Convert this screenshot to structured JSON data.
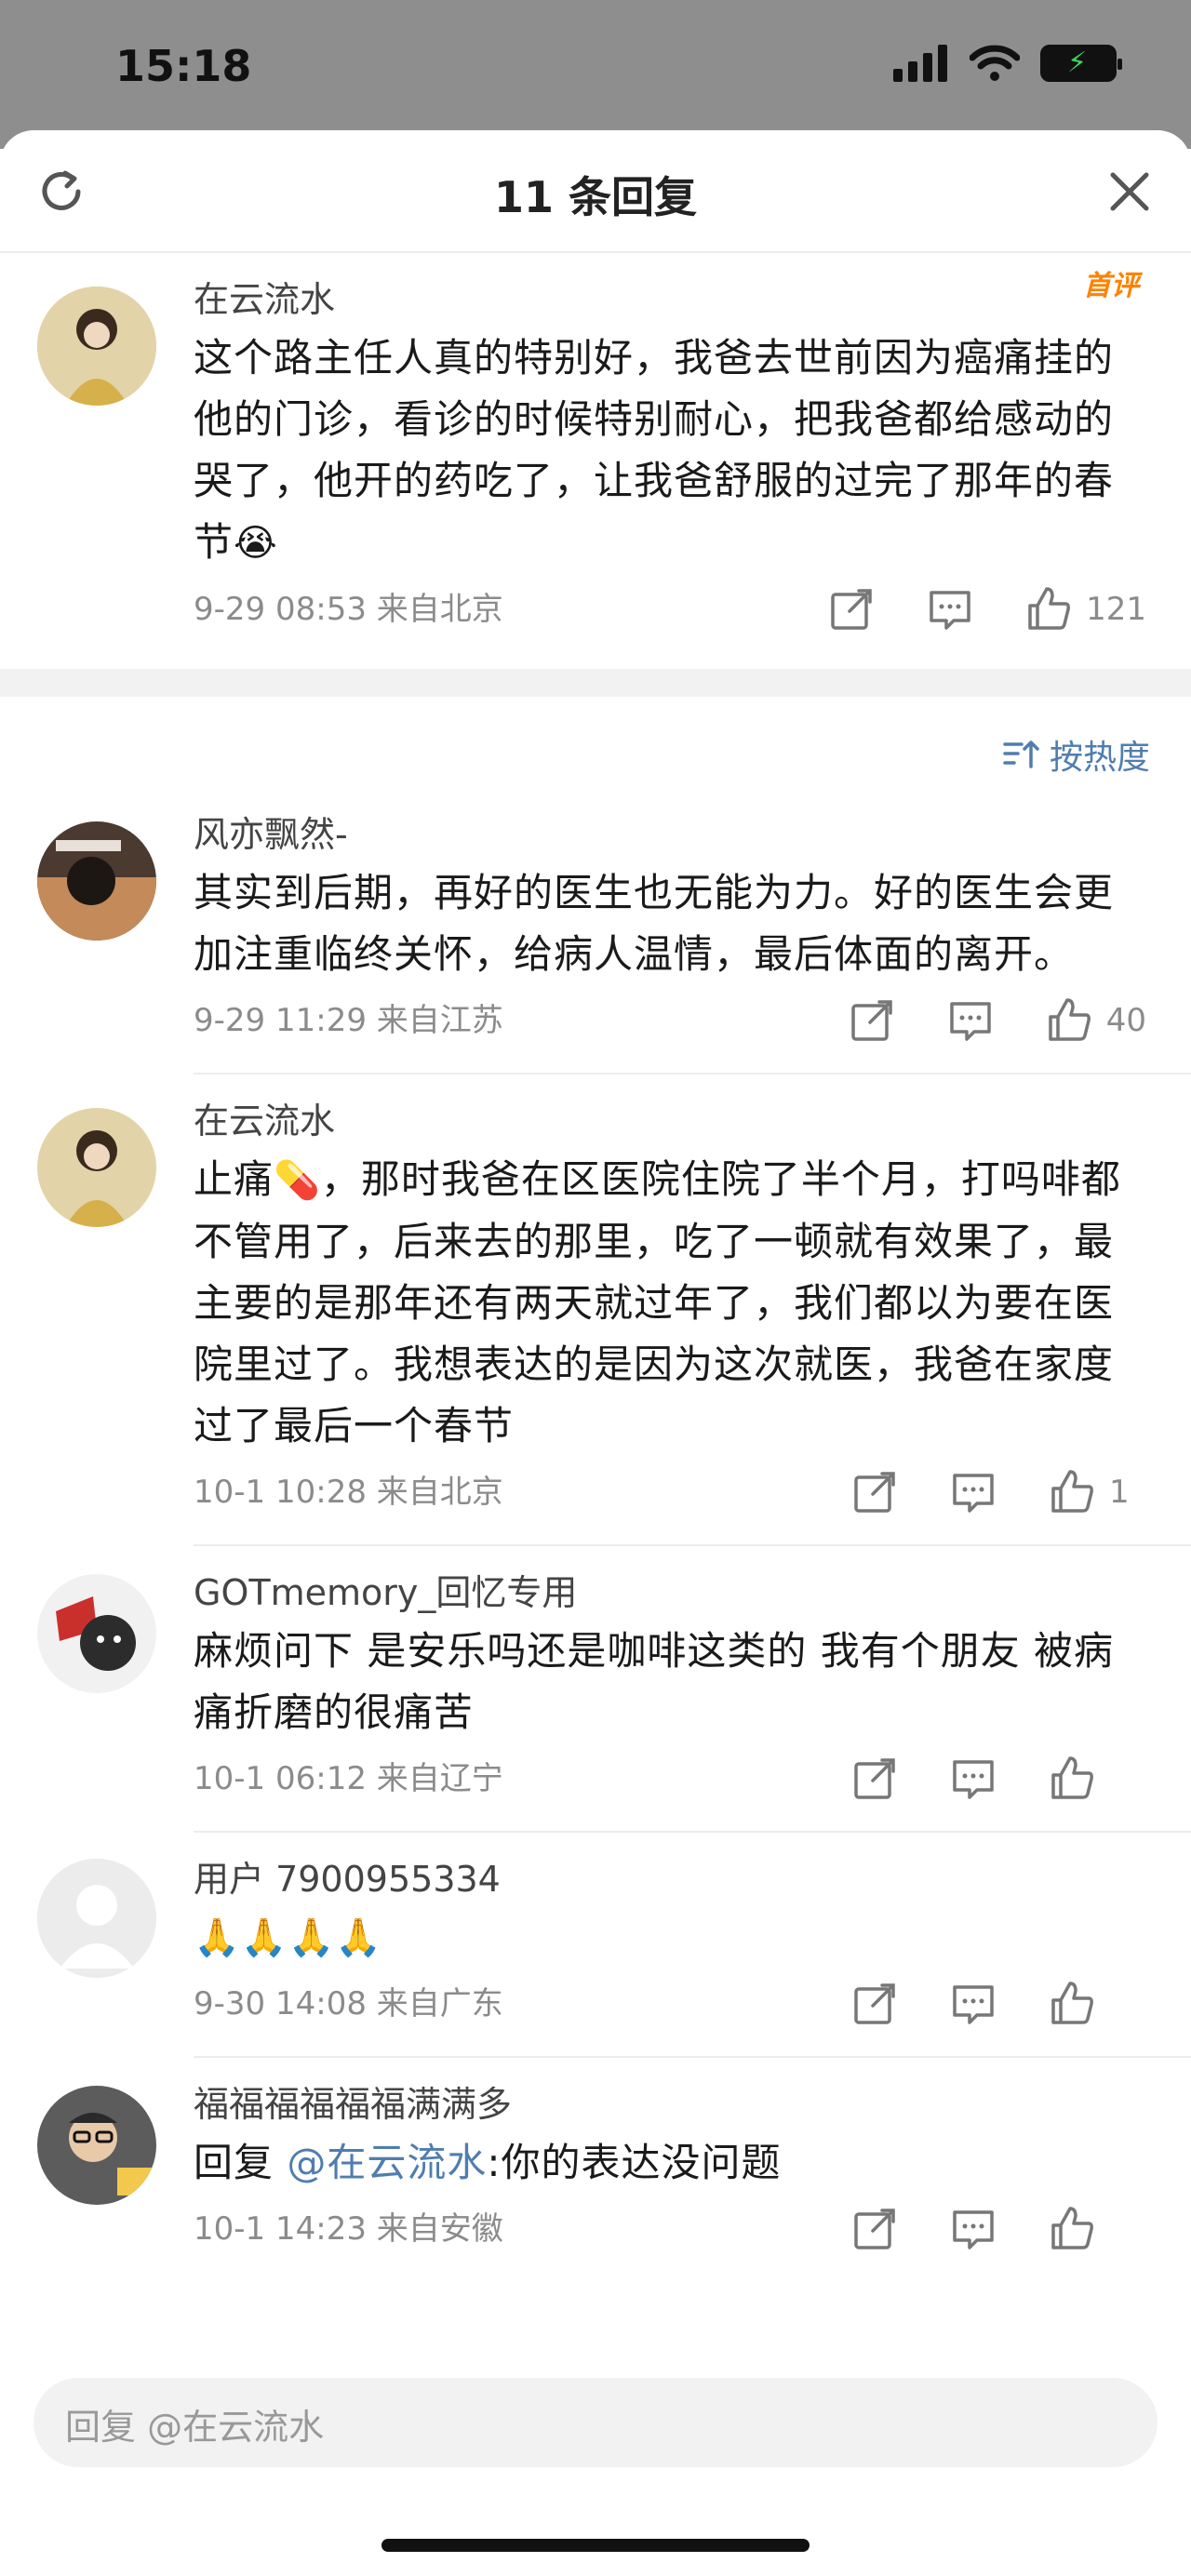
{
  "status": {
    "time": "15:18"
  },
  "sheet": {
    "title": "11 条回复"
  },
  "top_comment": {
    "name": "在云流水",
    "badge": "首评",
    "text": "这个路主任人真的特别好，我爸去世前因为癌痛挂的他的门诊，看诊的时候特别耐心，把我爸都给感动的哭了，他开的药吃了，让我爸舒服的过完了那年的春节",
    "emoji": "😭",
    "meta": "9-29 08:53  来自北京",
    "likes": "121"
  },
  "sort": {
    "label": "按热度"
  },
  "replies": [
    {
      "name": "风亦飘然-",
      "text": "其实到后期，再好的医生也无能为力。好的医生会更加注重临终关怀，给病人温情，最后体面的离开。",
      "meta": "9-29 11:29  来自江苏",
      "likes": "40"
    },
    {
      "name": "在云流水",
      "text_pre": "止痛",
      "emoji": "💊",
      "text": "，那时我爸在区医院住院了半个月，打吗啡都不管用了，后来去的那里，吃了一顿就有效果了，最主要的是那年还有两天就过年了，我们都以为要在医院里过了。我想表达的是因为这次就医，我爸在家度过了最后一个春节",
      "meta": "10-1 10:28  来自北京",
      "likes": "1"
    },
    {
      "name": "GOTmemory_回忆专用",
      "text": "麻烦问下 是安乐吗还是咖啡这类的 我有个朋友 被病痛折磨的很痛苦",
      "meta": "10-1 06:12  来自辽宁",
      "likes": ""
    },
    {
      "name": "用户 7900955334",
      "text": "🙏🙏🙏🙏",
      "meta": "9-30 14:08  来自广东",
      "likes": ""
    },
    {
      "name": "福福福福福福满满多",
      "reply_prefix": "回复 ",
      "mention": "@在云流水",
      "text": ":你的表达没问题",
      "meta": "10-1 14:23  来自安徽",
      "likes": ""
    }
  ],
  "reply_bar": {
    "placeholder": "回复 @在云流水"
  },
  "colors": {
    "link": "#507daf",
    "badge": "#ff8200",
    "meta": "#8b8b8b"
  }
}
